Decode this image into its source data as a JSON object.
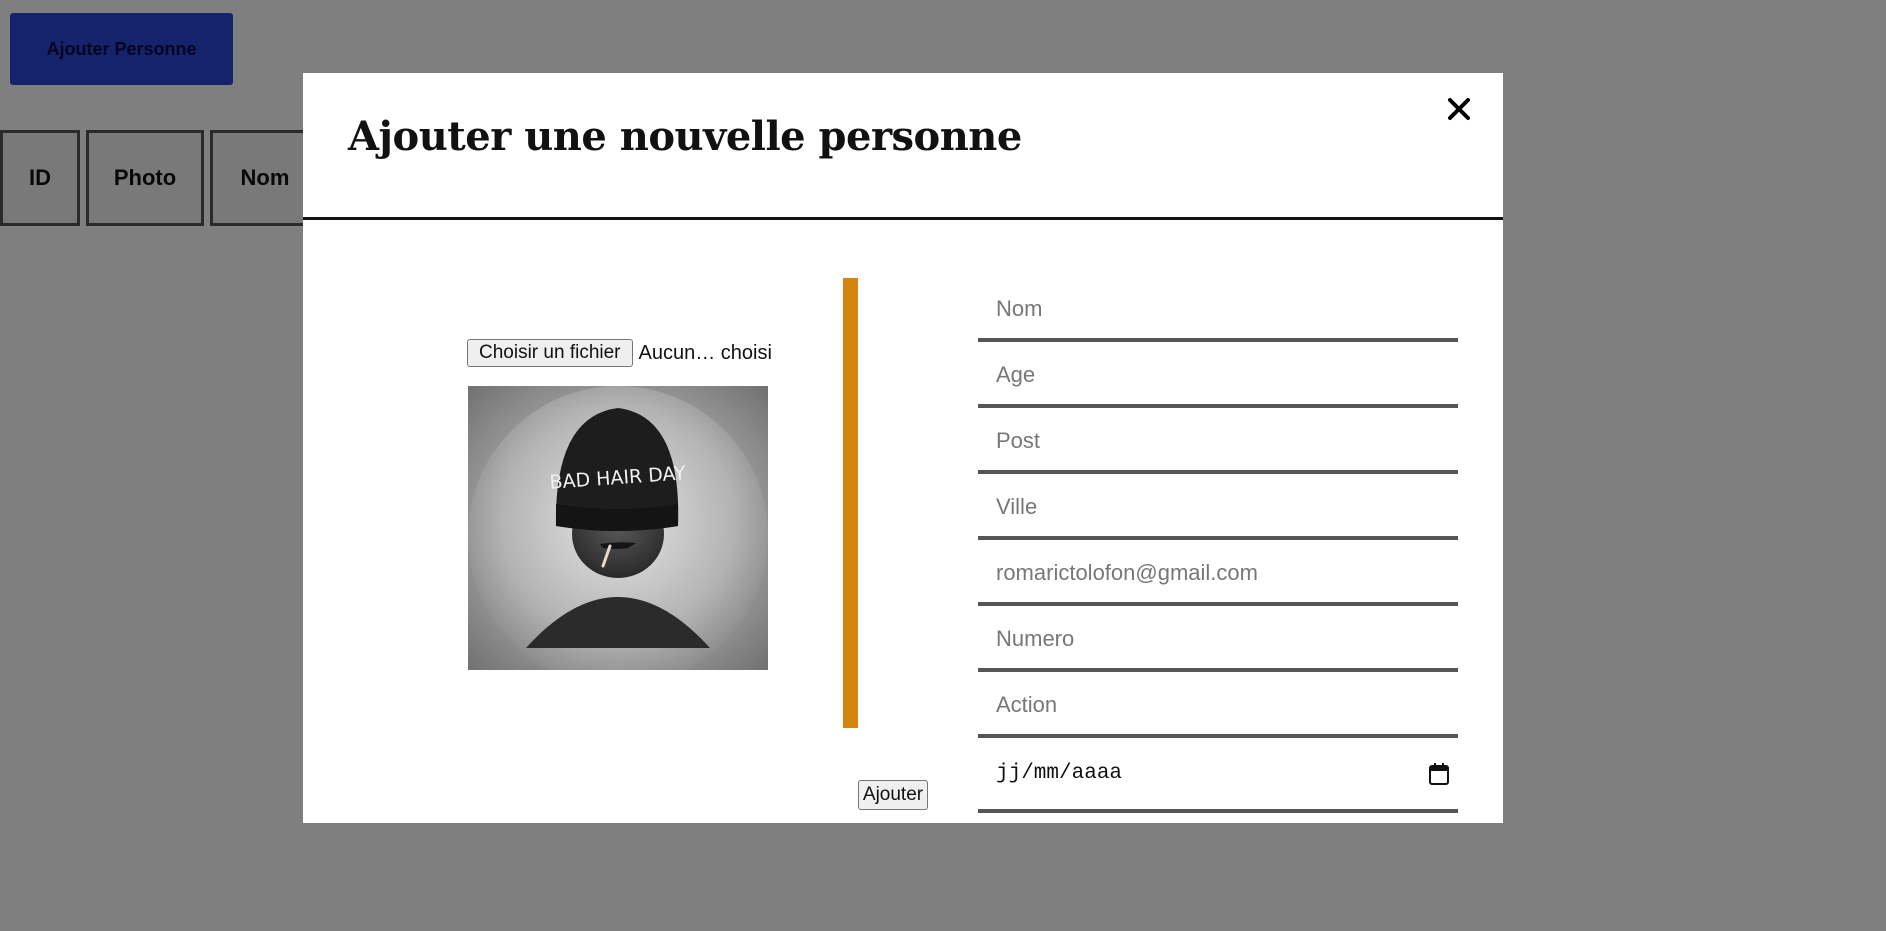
{
  "background": {
    "add_button_label": "Ajouter Personne",
    "table_headers": [
      "ID",
      "Photo",
      "Nom"
    ]
  },
  "modal": {
    "title": "Ajouter une nouvelle personne",
    "close_label": "✕",
    "file_input": {
      "button_label": "Choisir un fichier",
      "status_text": "Aucun… choisi"
    },
    "preview_hat_text": "BAD HAIR DAY",
    "fields": {
      "nom": "Nom",
      "age": "Age",
      "post": "Post",
      "ville": "Ville",
      "email": "romarictolofon@gmail.com",
      "numero": "Numero",
      "action": "Action"
    },
    "date_placeholder": "jj/mm/aaaa",
    "submit_label": "Ajouter",
    "accent_color": "#d68410"
  }
}
